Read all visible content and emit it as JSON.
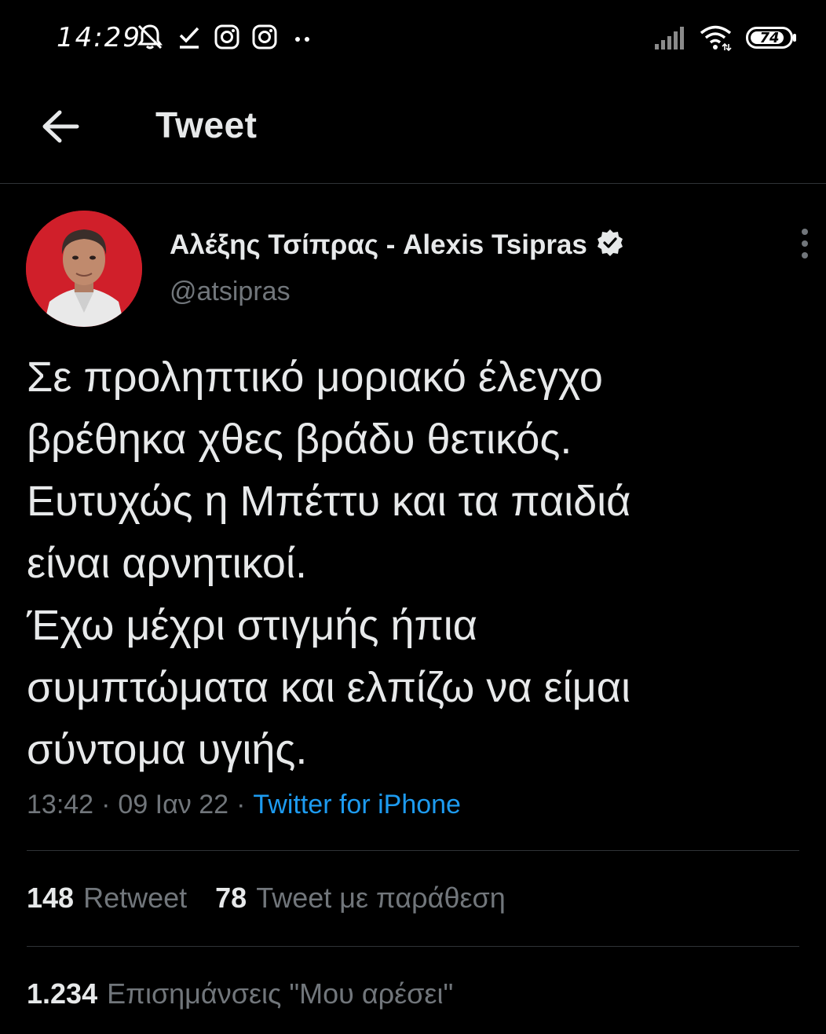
{
  "status_bar": {
    "time": "14:29",
    "icons_left": [
      "bell-off-icon",
      "download-done-icon",
      "instagram-icon",
      "instagram-icon",
      "more-dots-icon"
    ],
    "battery_level": "74"
  },
  "header": {
    "title": "Tweet",
    "back_icon": "arrow-left-icon"
  },
  "author": {
    "name": "Αλέξης Τσίπρας - Alexis Tsipras",
    "handle": "@atsipras",
    "verified": true
  },
  "tweet": {
    "text": "Σε προληπτικό μοριακό έλεγχο\nβρέθηκα χθες βράδυ θετικός.\nΕυτυχώς η Μπέττυ και τα παιδιά\nείναι αρνητικοί.\nΈχω μέχρι στιγμής ήπια\nσυμπτώματα και ελπίζω να είμαι\nσύντομα υγιής.",
    "time": "13:42",
    "date": "09 Ιαν 22",
    "separator": "·",
    "source": "Twitter for iPhone"
  },
  "stats": {
    "retweets_value": "148",
    "retweets_label": "Retweet",
    "quotes_value": "78",
    "quotes_label": "Tweet με παράθεση",
    "likes_value": "1.234",
    "likes_label": "Επισημάνσεις \"Μου αρέσει\""
  },
  "colors": {
    "background": "#000000",
    "text": "#e7e9ea",
    "secondary": "#71767b",
    "link": "#1d9bf0",
    "divider": "#2f3336",
    "avatar_bg": "#d01f2a"
  }
}
